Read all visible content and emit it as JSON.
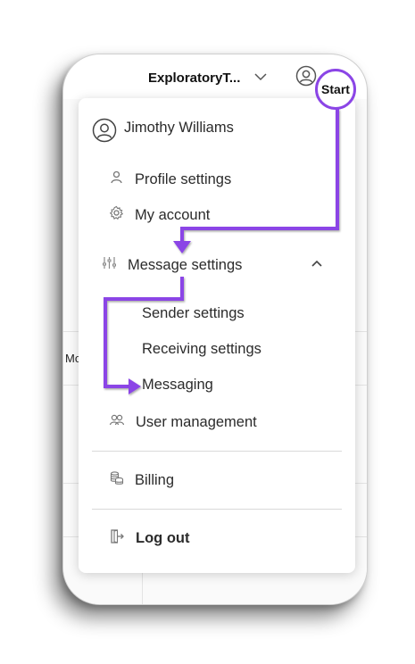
{
  "header": {
    "workspace_name": "ExploratoryT..."
  },
  "background": {
    "partial_text": "Mo"
  },
  "menu": {
    "user_name": "Jimothy Williams",
    "items": {
      "profile_settings": "Profile settings",
      "my_account": "My account",
      "message_settings": "Message settings",
      "sender_settings": "Sender settings",
      "receiving_settings": "Receiving settings",
      "messaging": "Messaging",
      "user_management": "User management",
      "billing": "Billing",
      "log_out": "Log out"
    }
  },
  "annotation": {
    "start_label": "Start",
    "accent_color": "#8b45e6"
  }
}
